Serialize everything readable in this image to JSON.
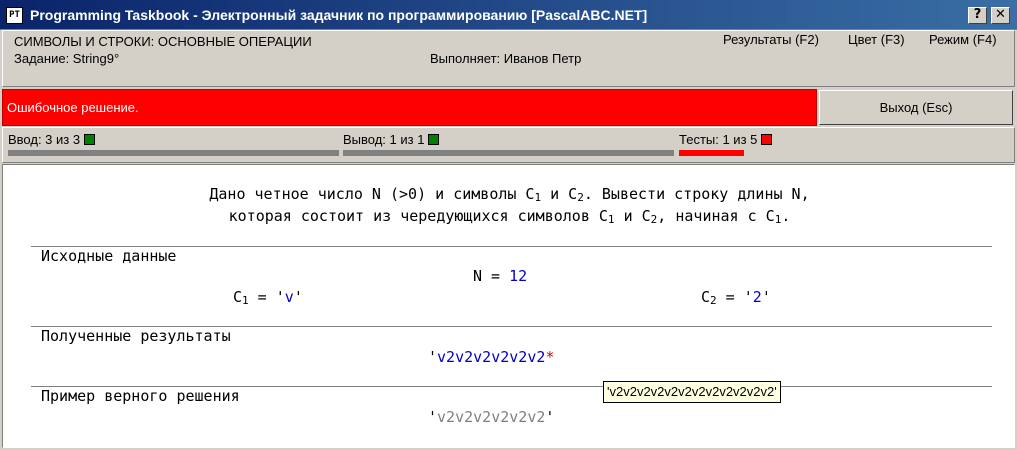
{
  "window": {
    "icon_text": "PT",
    "title": "Programming Taskbook - Электронный задачник по программированию [PascalABC.NET]",
    "help_btn": "?",
    "close_btn": "✕"
  },
  "header": {
    "section": "СИМВОЛЫ И СТРОКИ: ОСНОВНЫЕ ОПЕРАЦИИ",
    "task": "Задание: String9°",
    "performer": "Выполняет: Иванов Петр",
    "menu": [
      "Результаты (F2)",
      "Цвет (F3)",
      "Режим (F4)"
    ]
  },
  "error": {
    "message": "Ошибочное решение.",
    "exit_label": "Выход (Esc)"
  },
  "status": {
    "input_label": "Ввод: 3 из 3",
    "output_label": "Вывод: 1 из 1",
    "tests_label": "Тесты: 1 из 5",
    "input_progress": 1.0,
    "output_progress": 1.0,
    "tests_progress": 0.2
  },
  "task_text": {
    "line1_a": "Дано четное число N (>0) и символы C",
    "line1_b": " и C",
    "line1_c": ". Вывести строку длины N,",
    "line2_a": "которая состоит из чередующихся символов C",
    "line2_b": " и C",
    "line2_c": ", начиная с C",
    "line2_d": ".",
    "sub1": "1",
    "sub2": "2"
  },
  "sections": {
    "input": "Исходные данные",
    "results": "Полученные результаты",
    "example": "Пример верного решения"
  },
  "input_data": {
    "n_label": "N = ",
    "n_value": "12",
    "c1_label": "C",
    "c1_sub": "1",
    "c1_eq": " = '",
    "c1_value": "v",
    "c1_end": "'",
    "c2_label": "C",
    "c2_sub": "2",
    "c2_eq": " = '",
    "c2_value": "2",
    "c2_end": "'"
  },
  "results": {
    "quote_open": "'",
    "value": "v2v2v2v2v2v2",
    "marker": "*"
  },
  "example": {
    "quote_open": "'",
    "value": "v2v2v2v2v2v2",
    "quote_close": "'"
  },
  "tooltip": "'v2v2v2v2v2v2v2v2v2v2v2v2'"
}
